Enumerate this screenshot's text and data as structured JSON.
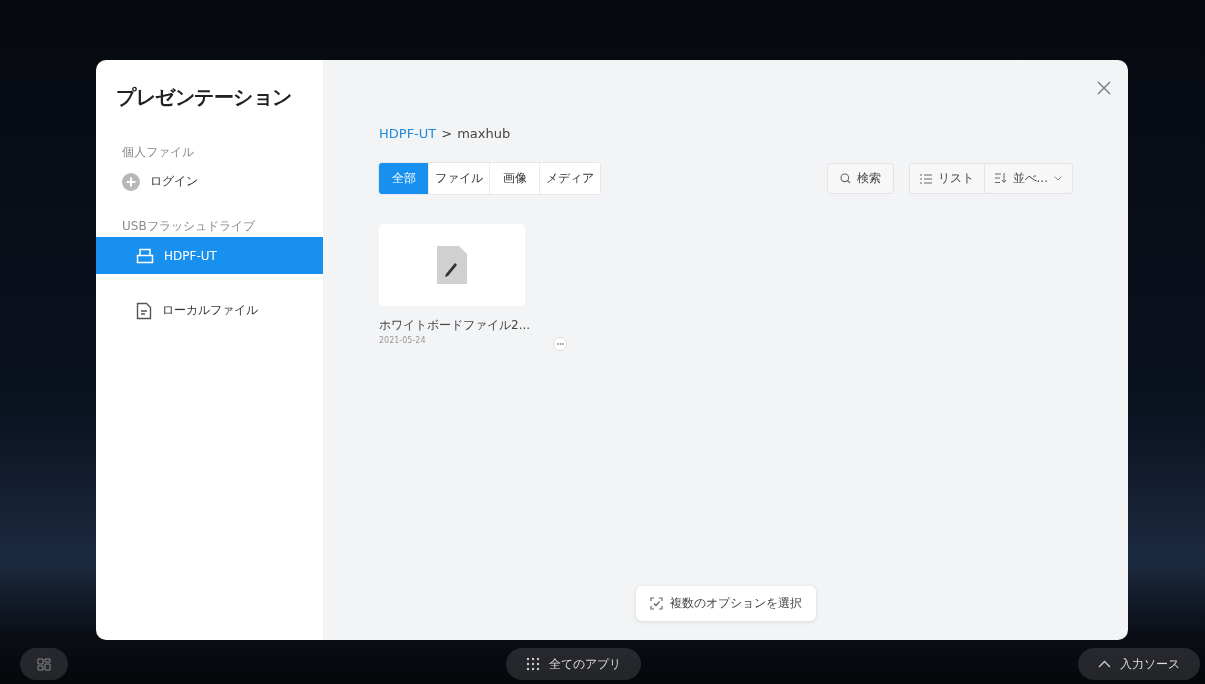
{
  "dialog": {
    "title": "プレゼンテーション"
  },
  "sidebar": {
    "sections": [
      {
        "heading": "個人ファイル",
        "items": [
          {
            "kind": "login",
            "label": "ログイン",
            "selected": false
          }
        ]
      },
      {
        "heading": "USBフラッシュドライブ",
        "items": [
          {
            "kind": "usb",
            "label": "HDPF-UT",
            "selected": true
          }
        ]
      },
      {
        "items": [
          {
            "kind": "local",
            "label": "ローカルファイル",
            "selected": false
          }
        ]
      }
    ]
  },
  "breadcrumb": {
    "parent": "HDPF-UT",
    "separator": ">",
    "current": "maxhub"
  },
  "filter_tabs": [
    {
      "label": "全部",
      "selected": true
    },
    {
      "label": "ファイル",
      "selected": false
    },
    {
      "label": "画像",
      "selected": false
    },
    {
      "label": "メディア",
      "selected": false
    }
  ],
  "search_button": "検索",
  "view_button": "リスト",
  "sort_button": "並べ...",
  "files": [
    {
      "name": "ホワイトボードファイル2...",
      "date": "2021-05-24"
    }
  ],
  "multi_select_button": "複数のオプションを選択",
  "taskbar": {
    "apps_button": "全てのアプリ",
    "input_source_button": "入力ソース"
  }
}
